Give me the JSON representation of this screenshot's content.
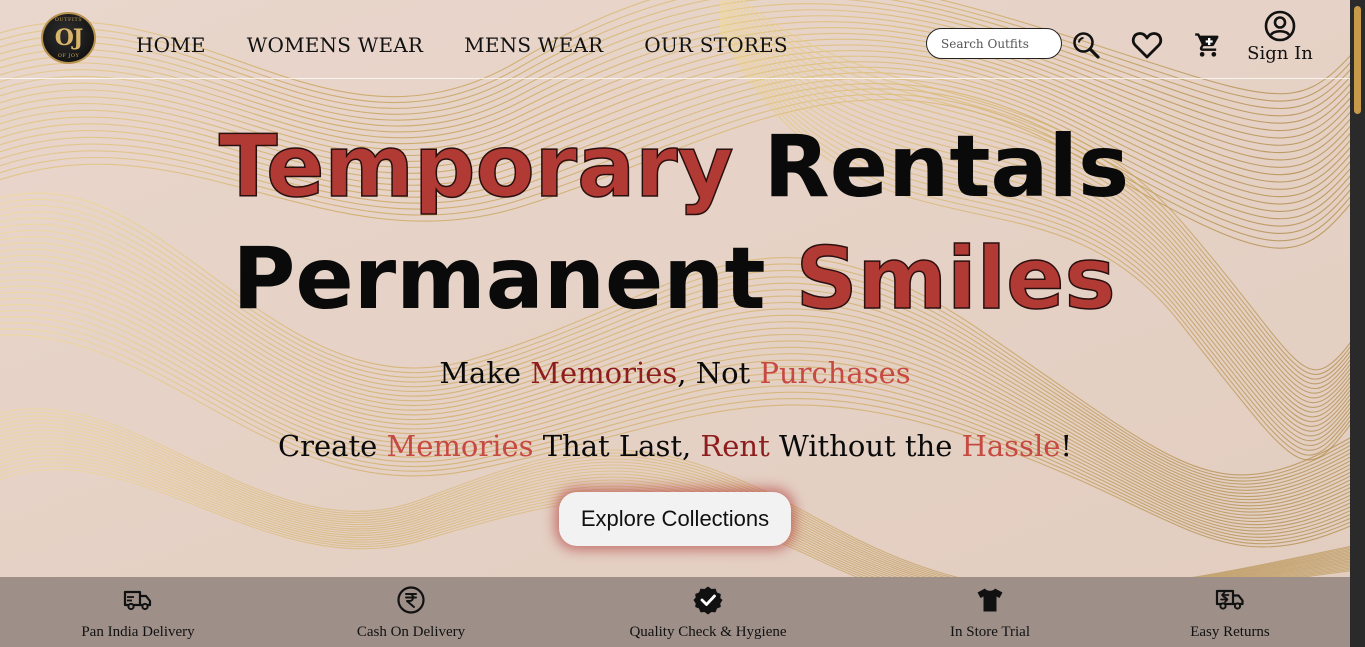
{
  "brand": {
    "logo_mark": "OJ",
    "logo_top_text": "OUTFITS",
    "logo_bottom_text": "OF JOY"
  },
  "nav": {
    "items": [
      "HOME",
      "WOMENS WEAR",
      "MENS WEAR",
      "OUR STORES"
    ]
  },
  "header": {
    "search_placeholder": "Search Outfits",
    "signin_label": "Sign In",
    "icons": [
      "search-icon",
      "heart-icon",
      "cart-icon",
      "user-circle-icon"
    ]
  },
  "hero": {
    "line1_part1": "Temporary",
    "line1_part2": "Rentals",
    "line2_part1": "Permanent",
    "line2_part2": "Smiles",
    "tagline": {
      "w1": "Make ",
      "w2": "Memories",
      "w3": ", Not ",
      "w4": "Purchases"
    },
    "subline": {
      "w1": "Create ",
      "w2": "Memories",
      "w3": " That Last, ",
      "w4": "Rent",
      "w5": " Without the ",
      "w6": "Hassle",
      "w7": "!"
    },
    "cta_label": "Explore Collections"
  },
  "features": [
    {
      "label": "Pan India Delivery",
      "icon": "truck-icon"
    },
    {
      "label": "Cash On Delivery",
      "icon": "rupee-icon"
    },
    {
      "label": "Quality Check & Hygiene",
      "icon": "verified-badge-icon"
    },
    {
      "label": "In Store Trial",
      "icon": "tshirt-icon"
    },
    {
      "label": "Easy Returns",
      "icon": "return-truck-icon"
    }
  ],
  "colors": {
    "accent_red": "#b13a34",
    "deep_red": "#8e1d1d",
    "features_bg": "#9e9089",
    "gold": "#c9a35c"
  }
}
